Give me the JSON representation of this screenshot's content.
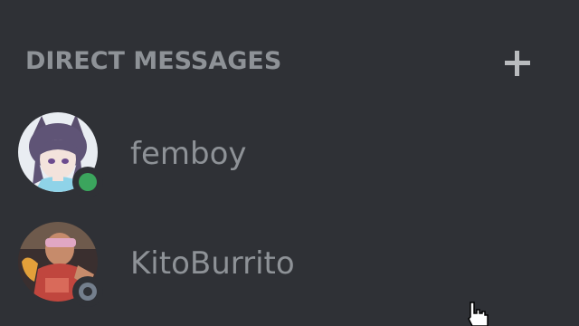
{
  "section": {
    "title": "DIRECT MESSAGES",
    "add_icon": "plus-icon"
  },
  "dms": [
    {
      "name": "femboy",
      "status": "online",
      "avatar": "anime-catgirl-avatar"
    },
    {
      "name": "KitoBurrito",
      "status": "offline",
      "avatar": "person-red-shirt-avatar"
    }
  ],
  "colors": {
    "background": "#2f3136",
    "text_muted": "#8e9297",
    "online": "#3ba55d",
    "offline": "#747f8d"
  }
}
